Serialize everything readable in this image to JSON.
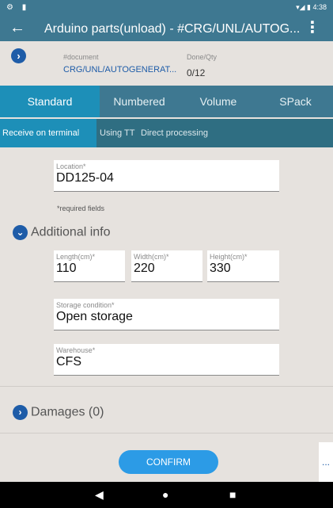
{
  "status_bar": {
    "left_icons": "⚙ ▮",
    "right_text": "▾◢ ▮ 4:38"
  },
  "app_bar": {
    "title": "Arduino parts(unload) - #CRG/UNL/AUTOG...",
    "back_icon": "arrow-back-icon",
    "menu_icon": "more-vert-icon"
  },
  "document": {
    "doc_label": "#document",
    "doc_value": "CRG/UNL/AUTOGENERAT...",
    "qty_label": "Done/Qty",
    "qty_value": "0/12"
  },
  "tabs": [
    "Standard",
    "Numbered",
    "Volume",
    "SPack"
  ],
  "subtabs": [
    "Receive on terminal",
    "Using TT",
    "Direct processing"
  ],
  "location": {
    "label": "Location*",
    "value": "DD125-04"
  },
  "required_note": "*required fields",
  "additional_info": {
    "label": "Additional info"
  },
  "dimensions": [
    {
      "label": "Length(cm)*",
      "value": "110"
    },
    {
      "label": "Width(cm)*",
      "value": "220"
    },
    {
      "label": "Height(cm)*",
      "value": "330"
    }
  ],
  "storage_condition": {
    "label": "Storage condition*",
    "value": "Open storage"
  },
  "warehouse": {
    "label": "Warehouse*",
    "value": "CFS"
  },
  "damages": {
    "label": "Damages (0)"
  },
  "confirm_label": "CONFIRM",
  "more_label": "...",
  "nav": {
    "back": "◀",
    "home": "●",
    "recents": "■"
  },
  "colors": {
    "primary": "#3e7891",
    "accent": "#1d8fb8",
    "button": "#2c9be6",
    "icon": "#1e5ca8"
  }
}
